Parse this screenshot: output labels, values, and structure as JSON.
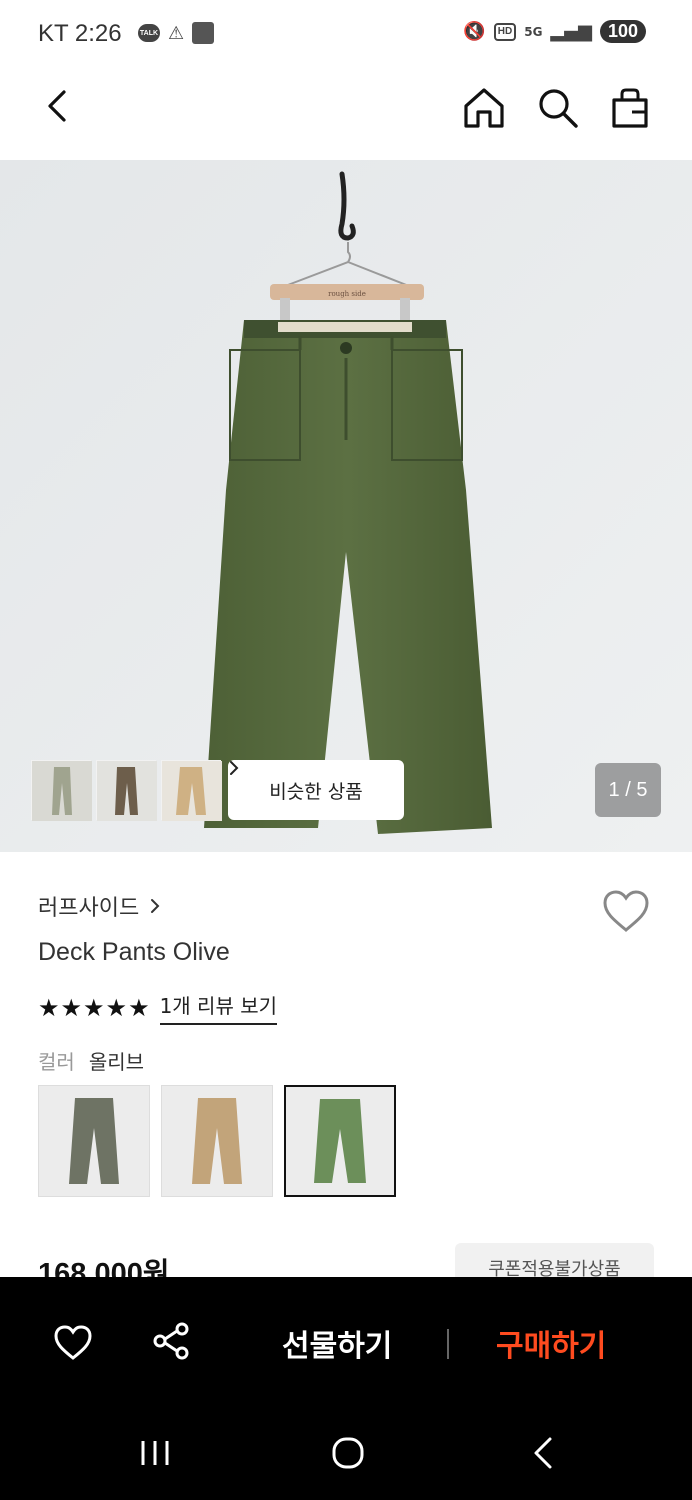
{
  "status_bar": {
    "carrier": "KT",
    "time": "2:26",
    "talk_label": "TALK",
    "hd_label": "HD",
    "network": "5G",
    "battery": "100"
  },
  "header": {
    "icons": [
      "back-icon",
      "home-icon",
      "search-icon",
      "shopping-bag-icon"
    ]
  },
  "gallery": {
    "similar_label": "비슷한 상품",
    "counter": "1 / 5",
    "image_hanger_text": "rough side",
    "thumbnails": [
      "gray-pants",
      "brown-pants",
      "beige-pants"
    ]
  },
  "product": {
    "brand": "러프사이드",
    "name": "Deck Pants Olive",
    "rating": 5,
    "review_link": "1개 리뷰 보기",
    "color_label": "컬러",
    "color_value": "올리브",
    "swatches": [
      "charcoal",
      "beige",
      "olive"
    ],
    "selected_swatch": 2,
    "price": "168,000원",
    "coupon_badge": "쿠폰적용불가상품"
  },
  "bottom_bar": {
    "gift_label": "선물하기",
    "buy_label": "구매하기",
    "buy_color": "#ff4b1f"
  },
  "nav": {
    "icons": [
      "recent-apps-icon",
      "home-circle-icon",
      "back-chevron-icon"
    ]
  }
}
